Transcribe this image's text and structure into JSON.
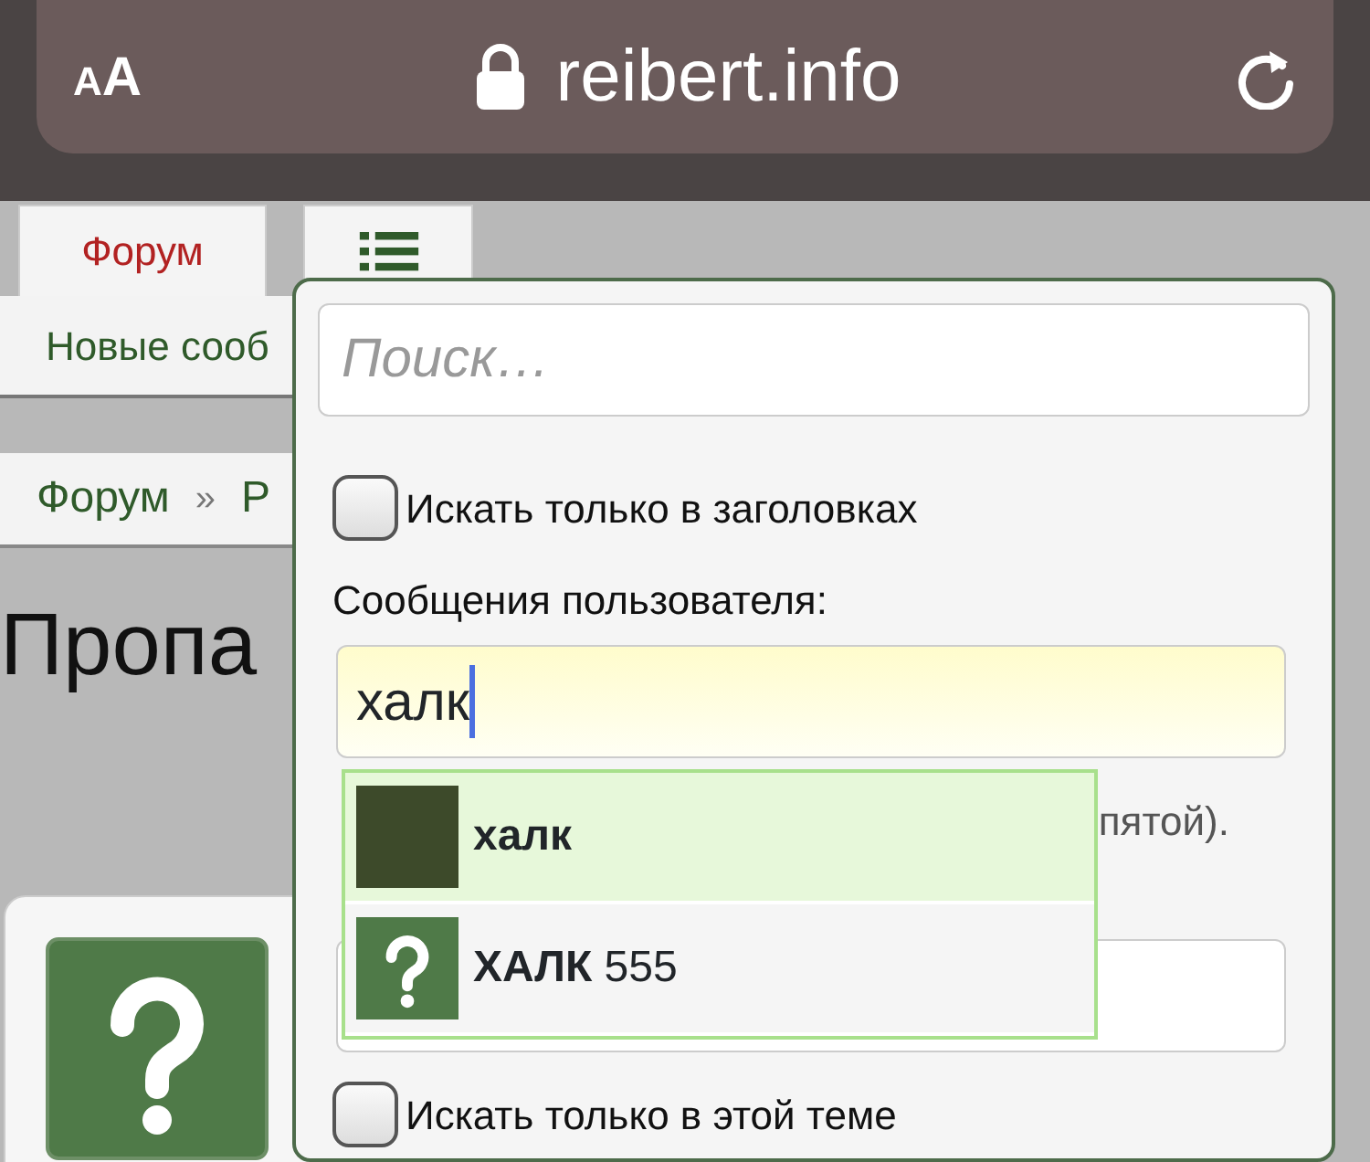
{
  "browser": {
    "text_size_button": "AA",
    "url": "reibert.info"
  },
  "tabs": [
    {
      "kind": "text",
      "label": "Форум",
      "selected": true
    },
    {
      "kind": "menu",
      "selected": false
    }
  ],
  "subnav": {
    "link": "Новые сооб"
  },
  "breadcrumb": {
    "items": [
      "Форум",
      "Р"
    ],
    "separator": "»"
  },
  "page_title": "Пропа",
  "search_popup": {
    "search": {
      "placeholder": "Поиск…"
    },
    "title_only_option": {
      "label": "Искать только в заголовках",
      "checked": false
    },
    "user_label": "Сообщения пользователя:",
    "user_field": {
      "value": "халк"
    },
    "hint": "пятой).",
    "suggestions": [
      {
        "name": "халк",
        "selected": true,
        "kind": "photo"
      },
      {
        "name": "**ХАЛК** 555",
        "selected": false,
        "kind": "placeholder"
      }
    ],
    "thread_only_option": {
      "label": "Искать только в этой теме",
      "checked": false
    }
  }
}
